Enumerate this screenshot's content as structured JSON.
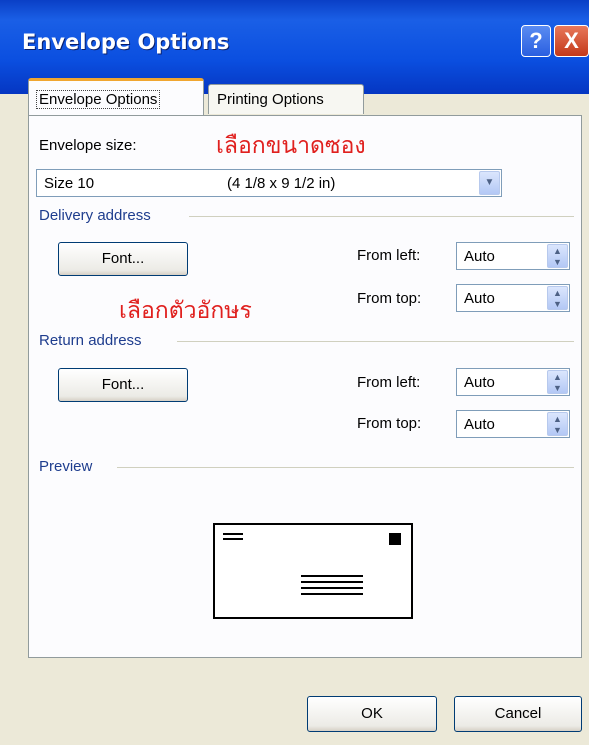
{
  "window": {
    "title": "Envelope Options"
  },
  "titlebar_buttons": {
    "help": "?",
    "close": "X"
  },
  "tabs": [
    {
      "label": "Envelope Options",
      "accesskey": "E",
      "active": true
    },
    {
      "label": "Printing Options",
      "accesskey": "P",
      "active": false
    }
  ],
  "envelope_size": {
    "label": "Envelope size:",
    "value_name": "Size 10",
    "value_dims": "(4 1/8 x 9 1/2 in)"
  },
  "annotations": {
    "size_note": "เลือกขนาดซอง",
    "font_note": "เลือกตัวอักษร"
  },
  "delivery": {
    "section_label": "Delivery address",
    "font_button": "Font...",
    "from_left_label": "From left:",
    "from_left_value": "Auto",
    "from_top_label": "From top:",
    "from_top_value": "Auto"
  },
  "return": {
    "section_label": "Return address",
    "font_button": "Font...",
    "from_left_label": "From left:",
    "from_left_value": "Auto",
    "from_top_label": "From top:",
    "from_top_value": "Auto"
  },
  "preview": {
    "section_label": "Preview"
  },
  "footer": {
    "ok": "OK",
    "cancel": "Cancel"
  },
  "colors": {
    "titlebar": "#0b4fe0",
    "dialog_bg": "#ECE9D8",
    "section_text": "#1e3d8e",
    "annotation": "#e0201e"
  }
}
